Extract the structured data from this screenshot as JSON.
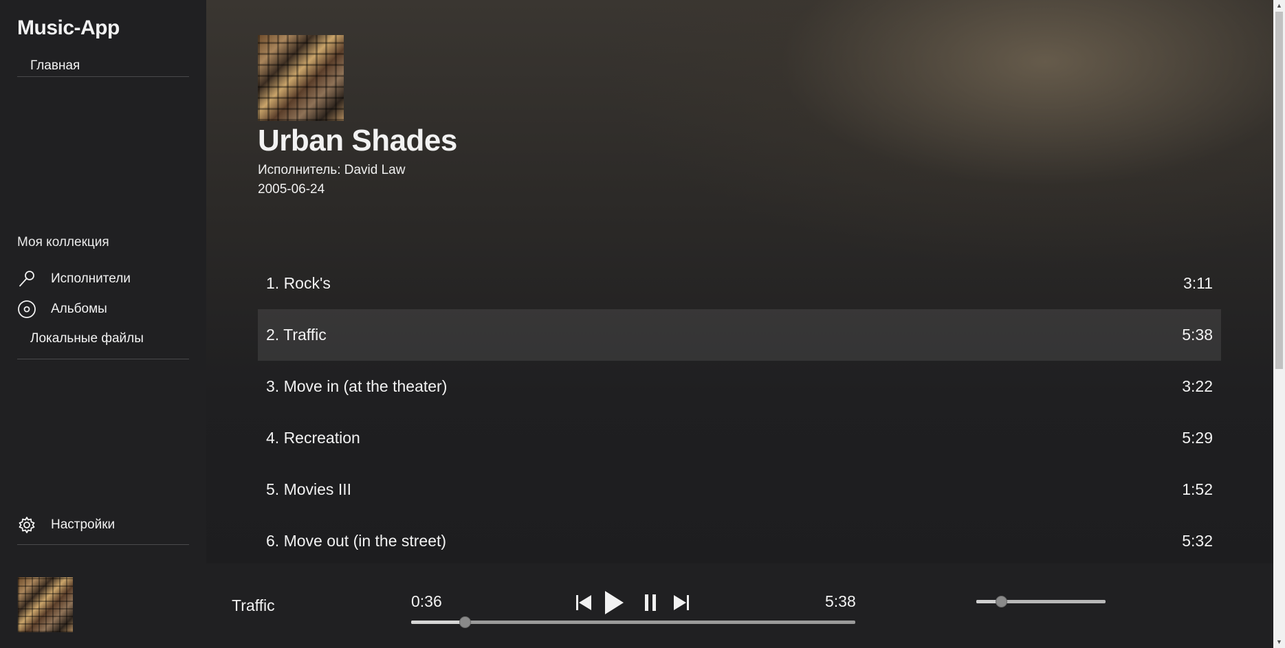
{
  "app": {
    "title": "Music-App"
  },
  "sidebar": {
    "home_label": "Главная",
    "collection_label": "Моя коллекция",
    "items": [
      {
        "label": "Исполнители",
        "icon": "microphone-icon"
      },
      {
        "label": "Альбомы",
        "icon": "disc-icon"
      },
      {
        "label": "Локальные файлы",
        "icon": ""
      }
    ],
    "settings": {
      "label": "Настройки",
      "icon": "gear-icon"
    }
  },
  "album": {
    "title": "Urban Shades",
    "artist_line": "Исполнитель: David Law",
    "date": "2005-06-24"
  },
  "tracks": [
    {
      "name": "1. Rock's",
      "duration": "3:11",
      "active": false
    },
    {
      "name": "2. Traffic",
      "duration": "5:38",
      "active": true
    },
    {
      "name": "3. Move in (at the theater)",
      "duration": "3:22",
      "active": false
    },
    {
      "name": "4. Recreation",
      "duration": "5:29",
      "active": false
    },
    {
      "name": "5. Movies III",
      "duration": "1:52",
      "active": false
    },
    {
      "name": "6. Move out (in the street)",
      "duration": "5:32",
      "active": false
    }
  ],
  "player": {
    "track_title": "Traffic",
    "elapsed": "0:36",
    "total": "5:38",
    "progress_fraction": 0.12,
    "volume_fraction": 0.19,
    "controls": [
      "previous-icon",
      "play-icon",
      "pause-icon",
      "next-icon"
    ]
  },
  "colors": {
    "background": "#1e1e20",
    "sidebar": "#202022",
    "text": "#f2f2f2",
    "active_row": "#3a3a3c"
  }
}
